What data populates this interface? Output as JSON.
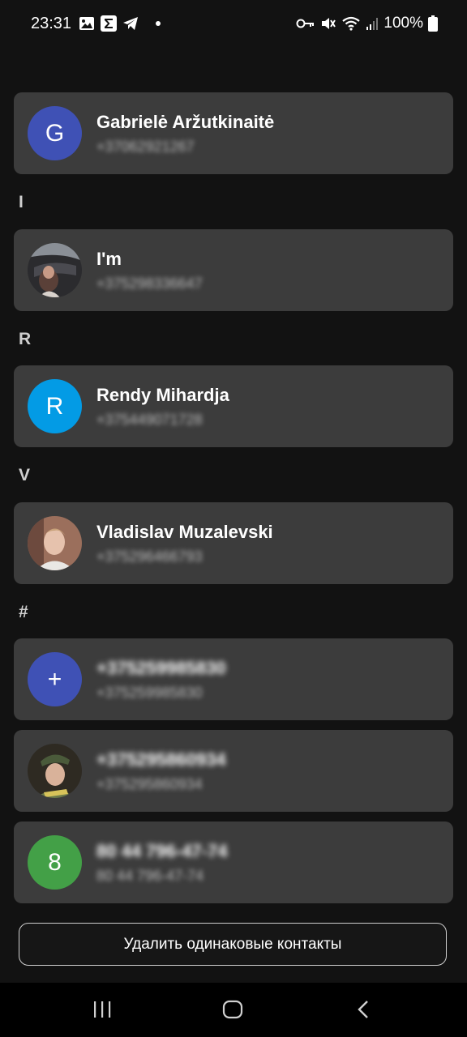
{
  "status_bar": {
    "time": "23:31",
    "battery": "100%",
    "left_icons": [
      "image-icon",
      "sigma-icon",
      "telegram-icon",
      "dot-icon"
    ],
    "right_icons": [
      "key-icon",
      "mute-icon",
      "wifi-icon",
      "signal-icon",
      "battery-icon"
    ]
  },
  "sections": [
    {
      "letter": ""
    },
    {
      "letter": "I"
    },
    {
      "letter": "R"
    },
    {
      "letter": "V"
    },
    {
      "letter": "#"
    }
  ],
  "contacts": [
    {
      "avatar_letter": "G",
      "avatar_color": "#3f51b5",
      "name": "Gabrielė Aržutkinaitė",
      "phone": "+37062921267"
    },
    {
      "avatar_letter": "",
      "avatar_color": "#2a2a2a",
      "avatar_photo": "photo-car-interior",
      "name": "I'm",
      "phone": "+375298336647"
    },
    {
      "avatar_letter": "R",
      "avatar_color": "#039be5",
      "name": "Rendy Mihardja",
      "phone": "+375449071728"
    },
    {
      "avatar_letter": "",
      "avatar_color": "#7a5a4a",
      "avatar_photo": "photo-man-portrait",
      "name": "Vladislav Muzalevski",
      "phone": "+375296466793"
    },
    {
      "avatar_letter": "+",
      "avatar_color": "#3f51b5",
      "name": "+375259985830",
      "phone": "+375259985830"
    },
    {
      "avatar_letter": "",
      "avatar_color": "#3a3a2e",
      "avatar_photo": "photo-man-cap",
      "name": "+375295860934",
      "phone": "+375295860934"
    },
    {
      "avatar_letter": "8",
      "avatar_color": "#43a047",
      "name": "80 44 796-47-74",
      "phone": "80 44 796-47-74"
    }
  ],
  "actions": {
    "dedupe_label": "Удалить одинаковые контакты"
  },
  "navigation": {
    "buttons": [
      "recent-apps-icon",
      "home-icon",
      "back-icon"
    ]
  }
}
